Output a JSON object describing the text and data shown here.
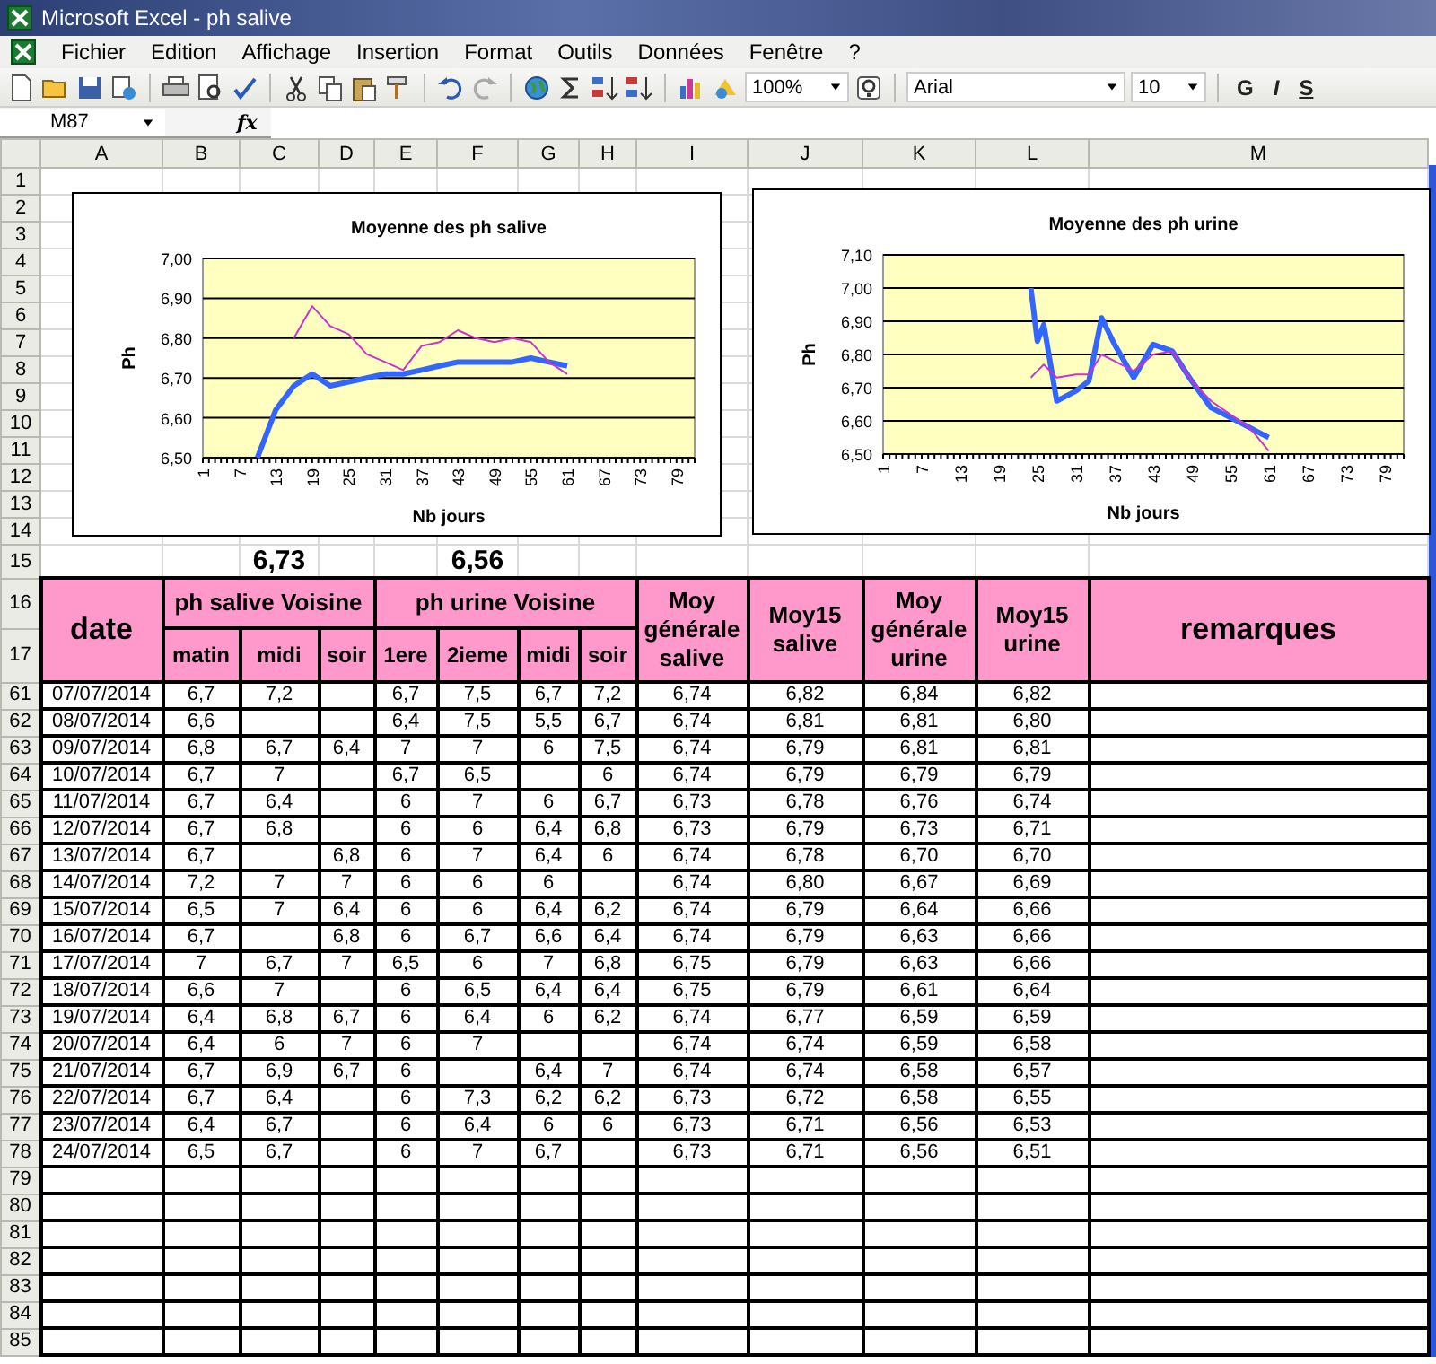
{
  "window": {
    "title": "Microsoft Excel - ph salive"
  },
  "menu": [
    "Fichier",
    "Edition",
    "Affichage",
    "Insertion",
    "Format",
    "Outils",
    "Données",
    "Fenêtre",
    "?"
  ],
  "toolbar": {
    "zoom": "100%",
    "font": "Arial",
    "font_size": "10",
    "format_buttons": [
      "G",
      "I",
      "S"
    ]
  },
  "formula_bar": {
    "name_box": "M87",
    "fx": "fx"
  },
  "columns": [
    "A",
    "B",
    "C",
    "D",
    "E",
    "F",
    "G",
    "H",
    "I",
    "J",
    "K",
    "L",
    "M"
  ],
  "top_rows": [
    "1",
    "2",
    "3",
    "4",
    "5",
    "6",
    "7",
    "8",
    "9",
    "10",
    "11",
    "12",
    "13",
    "14"
  ],
  "charts": [
    {
      "chart_data": {
        "type": "line",
        "title": "Moyenne des ph salive",
        "xlabel": "Nb jours",
        "ylabel": "Ph",
        "grid": true,
        "x": [
          10,
          13,
          16,
          19,
          22,
          25,
          28,
          31,
          34,
          37,
          40,
          43,
          46,
          49,
          52,
          55,
          58,
          61
        ],
        "xlim": [
          1,
          82
        ],
        "ylim": [
          6.5,
          7.0
        ],
        "series": [
          {
            "color": "#3366ff",
            "values": [
              6.5,
              6.62,
              6.68,
              6.71,
              6.68,
              6.69,
              6.7,
              6.71,
              6.71,
              6.72,
              6.73,
              6.74,
              6.74,
              6.74,
              6.74,
              6.75,
              6.74,
              6.73
            ]
          },
          {
            "color": "#cc33cc",
            "values": [
              null,
              null,
              6.8,
              6.88,
              6.83,
              6.81,
              6.76,
              6.74,
              6.72,
              6.78,
              6.79,
              6.82,
              6.8,
              6.79,
              6.8,
              6.79,
              6.74,
              6.71
            ]
          }
        ],
        "xticks": [
          1,
          7,
          13,
          19,
          25,
          31,
          37,
          43,
          49,
          55,
          61,
          67,
          73,
          79
        ],
        "yticks": [
          {
            "value": 6.5,
            "label": "6,50"
          },
          {
            "value": 6.6,
            "label": "6,60"
          },
          {
            "value": 6.7,
            "label": "6,70"
          },
          {
            "value": 6.8,
            "label": "6,80"
          },
          {
            "value": 6.9,
            "label": "6,90"
          },
          {
            "value": 7.0,
            "label": "7,00"
          }
        ]
      }
    },
    {
      "chart_data": {
        "type": "line",
        "title": "Moyenne des ph urine",
        "xlabel": "Nb jours",
        "ylabel": "Ph",
        "grid": true,
        "x": [
          24,
          25,
          26,
          28,
          31,
          33,
          35,
          37,
          40,
          43,
          46,
          49,
          52,
          55,
          58,
          61
        ],
        "xlim": [
          1,
          82
        ],
        "ylim": [
          6.5,
          7.1
        ],
        "series": [
          {
            "color": "#3366ff",
            "values": [
              7.0,
              6.84,
              6.89,
              6.66,
              6.69,
              6.72,
              6.91,
              6.83,
              6.73,
              6.83,
              6.81,
              6.72,
              6.64,
              6.61,
              6.58,
              6.55
            ]
          },
          {
            "color": "#cc33cc",
            "values": [
              6.73,
              6.75,
              6.77,
              6.73,
              6.74,
              6.74,
              6.8,
              6.78,
              6.75,
              6.8,
              6.81,
              6.72,
              6.66,
              6.62,
              6.58,
              6.51
            ]
          }
        ],
        "xticks": [
          1,
          7,
          13,
          19,
          25,
          31,
          37,
          43,
          49,
          55,
          61,
          67,
          73,
          79
        ],
        "yticks": [
          {
            "value": 6.5,
            "label": "6,50"
          },
          {
            "value": 6.6,
            "label": "6,60"
          },
          {
            "value": 6.7,
            "label": "6,70"
          },
          {
            "value": 6.8,
            "label": "6,80"
          },
          {
            "value": 6.9,
            "label": "6,90"
          },
          {
            "value": 7.0,
            "label": "7,00"
          },
          {
            "value": 7.1,
            "label": "7,10"
          }
        ]
      }
    }
  ],
  "summary_row": {
    "number": "15",
    "salive_average": "6,73",
    "urine_average": "6,56"
  },
  "header": {
    "rows": [
      "16",
      "17"
    ],
    "date": "date",
    "salive_group": "ph salive Voisine",
    "salive_cols": [
      "matin",
      "midi",
      "soir"
    ],
    "urine_group": "ph urine Voisine",
    "urine_cols": [
      "1ere",
      "2ieme",
      "midi",
      "soir"
    ],
    "averages": [
      "Moy générale salive",
      "Moy15 salive",
      "Moy générale urine",
      "Moy15 urine"
    ],
    "remarks": "remarques"
  },
  "rows": [
    {
      "number": "61",
      "date": "07/07/2014",
      "salive": {
        "matin": "6,7",
        "midi": "7,2"
      },
      "urine": {
        "1ere": "6,7",
        "2ieme": "7,5",
        "midi": "6,7",
        "soir": "7,2"
      },
      "averages": [
        "6,74",
        "6,82",
        "6,84",
        "6,82"
      ]
    },
    {
      "number": "62",
      "date": "08/07/2014",
      "salive": {
        "matin": "6,6"
      },
      "urine": {
        "1ere": "6,4",
        "2ieme": "7,5",
        "midi": "5,5",
        "soir": "6,7"
      },
      "averages": [
        "6,74",
        "6,81",
        "6,81",
        "6,80"
      ]
    },
    {
      "number": "63",
      "date": "09/07/2014",
      "salive": {
        "matin": "6,8",
        "midi": "6,7",
        "soir": "6,4"
      },
      "urine": {
        "1ere": "7",
        "2ieme": "7",
        "midi": "6",
        "soir": "7,5"
      },
      "averages": [
        "6,74",
        "6,79",
        "6,81",
        "6,81"
      ]
    },
    {
      "number": "64",
      "date": "10/07/2014",
      "salive": {
        "matin": "6,7",
        "midi": "7"
      },
      "urine": {
        "1ere": "6,7",
        "2ieme": "6,5",
        "soir": "6"
      },
      "averages": [
        "6,74",
        "6,79",
        "6,79",
        "6,79"
      ]
    },
    {
      "number": "65",
      "date": "11/07/2014",
      "salive": {
        "matin": "6,7",
        "midi": "6,4"
      },
      "urine": {
        "1ere": "6",
        "2ieme": "7",
        "midi": "6",
        "soir": "6,7"
      },
      "averages": [
        "6,73",
        "6,78",
        "6,76",
        "6,74"
      ]
    },
    {
      "number": "66",
      "date": "12/07/2014",
      "salive": {
        "matin": "6,7",
        "midi": "6,8"
      },
      "urine": {
        "1ere": "6",
        "2ieme": "6",
        "midi": "6,4",
        "soir": "6,8"
      },
      "averages": [
        "6,73",
        "6,79",
        "6,73",
        "6,71"
      ]
    },
    {
      "number": "67",
      "date": "13/07/2014",
      "salive": {
        "matin": "6,7",
        "soir": "6,8"
      },
      "urine": {
        "1ere": "6",
        "2ieme": "7",
        "midi": "6,4",
        "soir": "6"
      },
      "averages": [
        "6,74",
        "6,78",
        "6,70",
        "6,70"
      ]
    },
    {
      "number": "68",
      "date": "14/07/2014",
      "salive": {
        "matin": "7,2",
        "midi": "7",
        "soir": "7"
      },
      "urine": {
        "1ere": "6",
        "2ieme": "6",
        "midi": "6"
      },
      "averages": [
        "6,74",
        "6,80",
        "6,67",
        "6,69"
      ]
    },
    {
      "number": "69",
      "date": "15/07/2014",
      "salive": {
        "matin": "6,5",
        "midi": "7",
        "soir": "6,4"
      },
      "urine": {
        "1ere": "6",
        "2ieme": "6",
        "midi": "6,4",
        "soir": "6,2"
      },
      "averages": [
        "6,74",
        "6,79",
        "6,64",
        "6,66"
      ]
    },
    {
      "number": "70",
      "date": "16/07/2014",
      "salive": {
        "matin": "6,7",
        "soir": "6,8"
      },
      "urine": {
        "1ere": "6",
        "2ieme": "6,7",
        "midi": "6,6",
        "soir": "6,4"
      },
      "averages": [
        "6,74",
        "6,79",
        "6,63",
        "6,66"
      ]
    },
    {
      "number": "71",
      "date": "17/07/2014",
      "salive": {
        "matin": "7",
        "midi": "6,7",
        "soir": "7"
      },
      "urine": {
        "1ere": "6,5",
        "2ieme": "6",
        "midi": "7",
        "soir": "6,8"
      },
      "averages": [
        "6,75",
        "6,79",
        "6,63",
        "6,66"
      ]
    },
    {
      "number": "72",
      "date": "18/07/2014",
      "salive": {
        "matin": "6,6",
        "midi": "7"
      },
      "urine": {
        "1ere": "6",
        "2ieme": "6,5",
        "midi": "6,4",
        "soir": "6,4"
      },
      "averages": [
        "6,75",
        "6,79",
        "6,61",
        "6,64"
      ]
    },
    {
      "number": "73",
      "date": "19/07/2014",
      "salive": {
        "matin": "6,4",
        "midi": "6,8",
        "soir": "6,7"
      },
      "urine": {
        "1ere": "6",
        "2ieme": "6,4",
        "midi": "6",
        "soir": "6,2"
      },
      "averages": [
        "6,74",
        "6,77",
        "6,59",
        "6,59"
      ]
    },
    {
      "number": "74",
      "date": "20/07/2014",
      "salive": {
        "matin": "6,4",
        "midi": "6",
        "soir": "7"
      },
      "urine": {
        "1ere": "6",
        "2ieme": "7"
      },
      "averages": [
        "6,74",
        "6,74",
        "6,59",
        "6,58"
      ]
    },
    {
      "number": "75",
      "date": "21/07/2014",
      "salive": {
        "matin": "6,7",
        "midi": "6,9",
        "soir": "6,7"
      },
      "urine": {
        "1ere": "6",
        "midi": "6,4",
        "soir": "7"
      },
      "averages": [
        "6,74",
        "6,74",
        "6,58",
        "6,57"
      ]
    },
    {
      "number": "76",
      "date": "22/07/2014",
      "salive": {
        "matin": "6,7",
        "midi": "6,4"
      },
      "urine": {
        "1ere": "6",
        "2ieme": "7,3",
        "midi": "6,2",
        "soir": "6,2"
      },
      "averages": [
        "6,73",
        "6,72",
        "6,58",
        "6,55"
      ]
    },
    {
      "number": "77",
      "date": "23/07/2014",
      "salive": {
        "matin": "6,4",
        "midi": "6,7"
      },
      "urine": {
        "1ere": "6",
        "2ieme": "6,4",
        "midi": "6",
        "soir": "6"
      },
      "averages": [
        "6,73",
        "6,71",
        "6,56",
        "6,53"
      ]
    },
    {
      "number": "78",
      "date": "24/07/2014",
      "salive": {
        "matin": "6,5",
        "midi": "6,7"
      },
      "urine": {
        "1ere": "6",
        "2ieme": "7",
        "midi": "6,7"
      },
      "averages": [
        "6,73",
        "6,71",
        "6,56",
        "6,51"
      ]
    },
    {
      "number": "79"
    },
    {
      "number": "80"
    },
    {
      "number": "81"
    },
    {
      "number": "82"
    },
    {
      "number": "83"
    },
    {
      "number": "84"
    },
    {
      "number": "85"
    }
  ]
}
